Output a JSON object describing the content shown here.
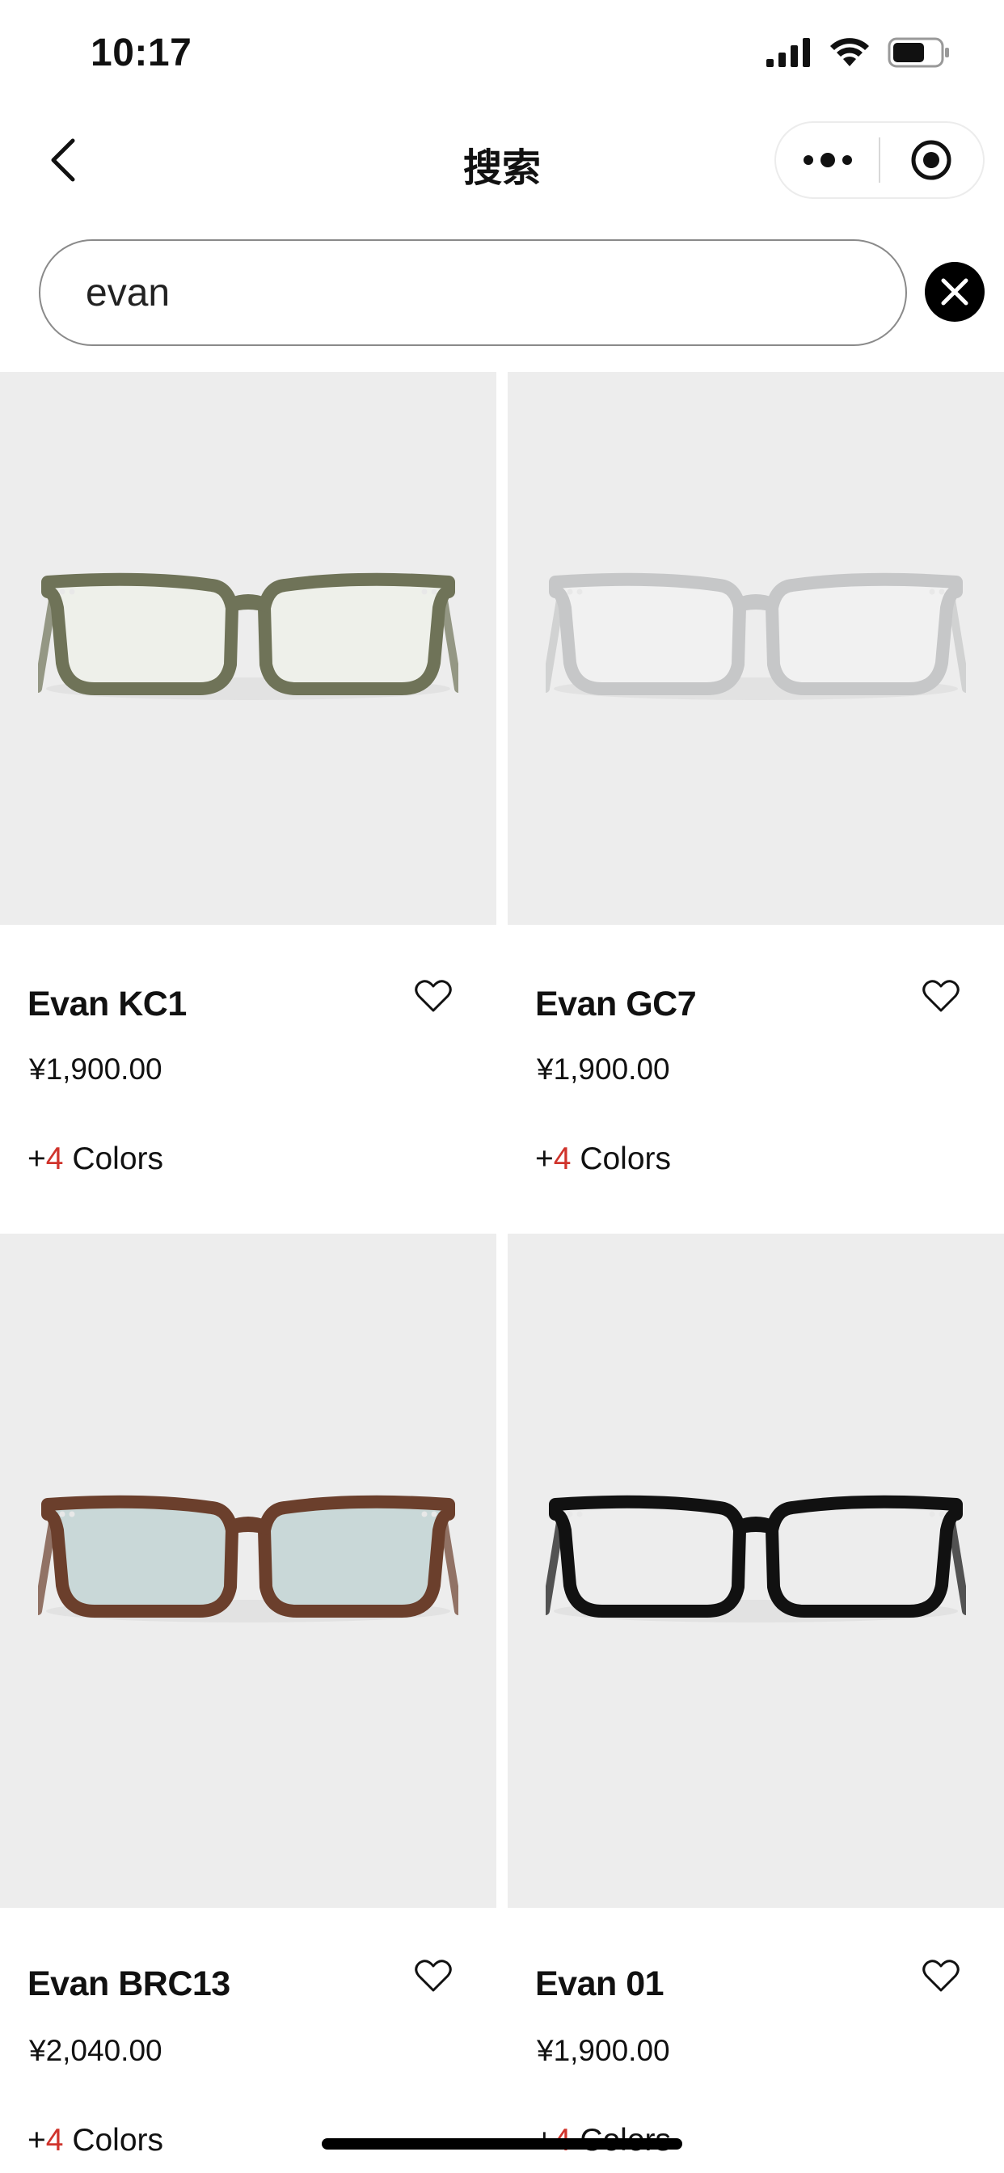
{
  "status_bar": {
    "time": "10:17"
  },
  "nav": {
    "title": "搜索",
    "back_icon": "chevron-left-icon",
    "more_icon": "more-dots-icon",
    "close_icon": "target-circle-icon"
  },
  "search": {
    "value": "evan",
    "clear_icon": "close-circle-icon"
  },
  "products": [
    {
      "name": "Evan KC1",
      "price": "¥1,900.00",
      "colors_prefix": "+",
      "colors_count": "4",
      "colors_label": " Colors",
      "frame_color": "#6f7358",
      "lens_tint": "#eef0ea"
    },
    {
      "name": "Evan GC7",
      "price": "¥1,900.00",
      "colors_prefix": "+",
      "colors_count": "4",
      "colors_label": " Colors",
      "frame_color": "#c6c7c8",
      "lens_tint": "#f1f1f1"
    },
    {
      "name": "Evan BRC13",
      "price": "¥2,040.00",
      "colors_prefix": "+",
      "colors_count": "4",
      "colors_label": " Colors",
      "frame_color": "#6b3f2c",
      "lens_tint": "#c9d8d8"
    },
    {
      "name": "Evan 01",
      "price": "¥1,900.00",
      "colors_prefix": "+",
      "colors_count": "4",
      "colors_label": " Colors",
      "frame_color": "#111111",
      "lens_tint": "#ededed"
    }
  ],
  "colors": {
    "accent_red": "#d0342c",
    "image_bg": "#ededed"
  }
}
